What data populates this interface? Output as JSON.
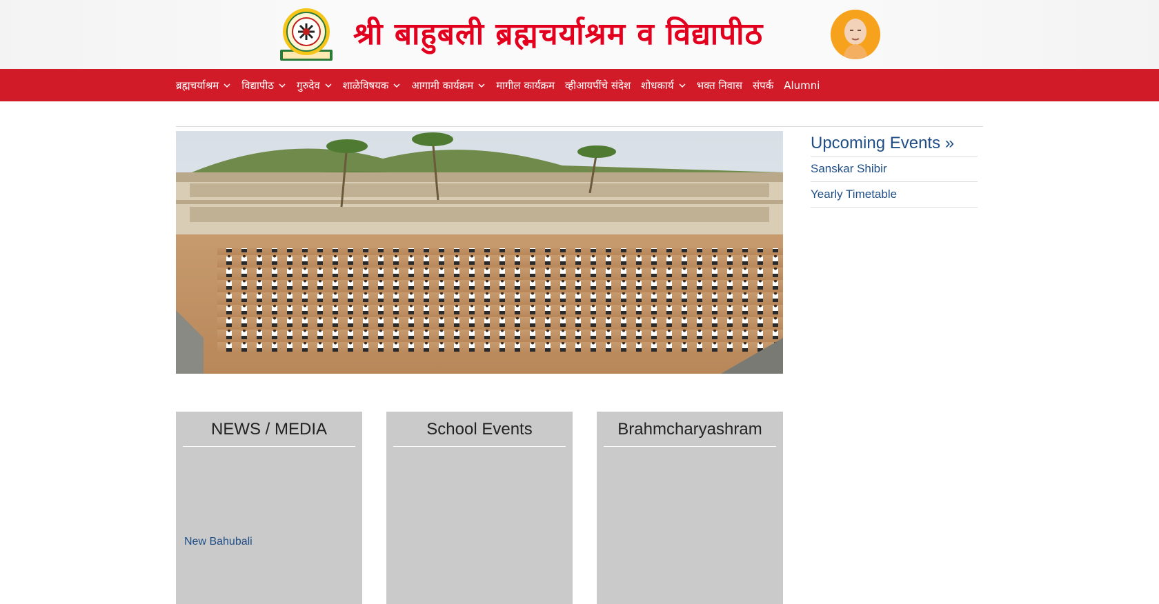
{
  "header": {
    "title": "श्री बाहुबली ब्रह्मचर्याश्रम व विद्यापीठ",
    "logo_icon": "institution-emblem-icon",
    "photo_icon": "guru-portrait-icon",
    "title_color": "#e3001e"
  },
  "nav": {
    "bg_color": "#d21b29",
    "items": [
      {
        "label": "ब्रह्मचर्याश्रम",
        "has_dropdown": true
      },
      {
        "label": "विद्यापीठ",
        "has_dropdown": true
      },
      {
        "label": "गुरुदेव",
        "has_dropdown": true
      },
      {
        "label": "शाळेविषयक",
        "has_dropdown": true
      },
      {
        "label": "आगामी कार्यक्रम",
        "has_dropdown": true
      },
      {
        "label": "मागील कार्यक्रम",
        "has_dropdown": false
      },
      {
        "label": "व्हीआयपींचे संदेश",
        "has_dropdown": false
      },
      {
        "label": "शोधकार्य",
        "has_dropdown": true
      },
      {
        "label": "भक्त निवास",
        "has_dropdown": false
      },
      {
        "label": "संपर्क",
        "has_dropdown": false
      },
      {
        "label": "Alumni",
        "has_dropdown": false
      }
    ]
  },
  "sidebar": {
    "title": "Upcoming Events »",
    "links": [
      "Sanskar Shibir",
      "Yearly Timetable"
    ],
    "link_color": "#1f4e86"
  },
  "panels": [
    {
      "title": "NEWS / MEDIA",
      "link": "New Bahubali"
    },
    {
      "title": "School Events",
      "link": ""
    },
    {
      "title": "Brahmcharyashram",
      "link": ""
    }
  ]
}
